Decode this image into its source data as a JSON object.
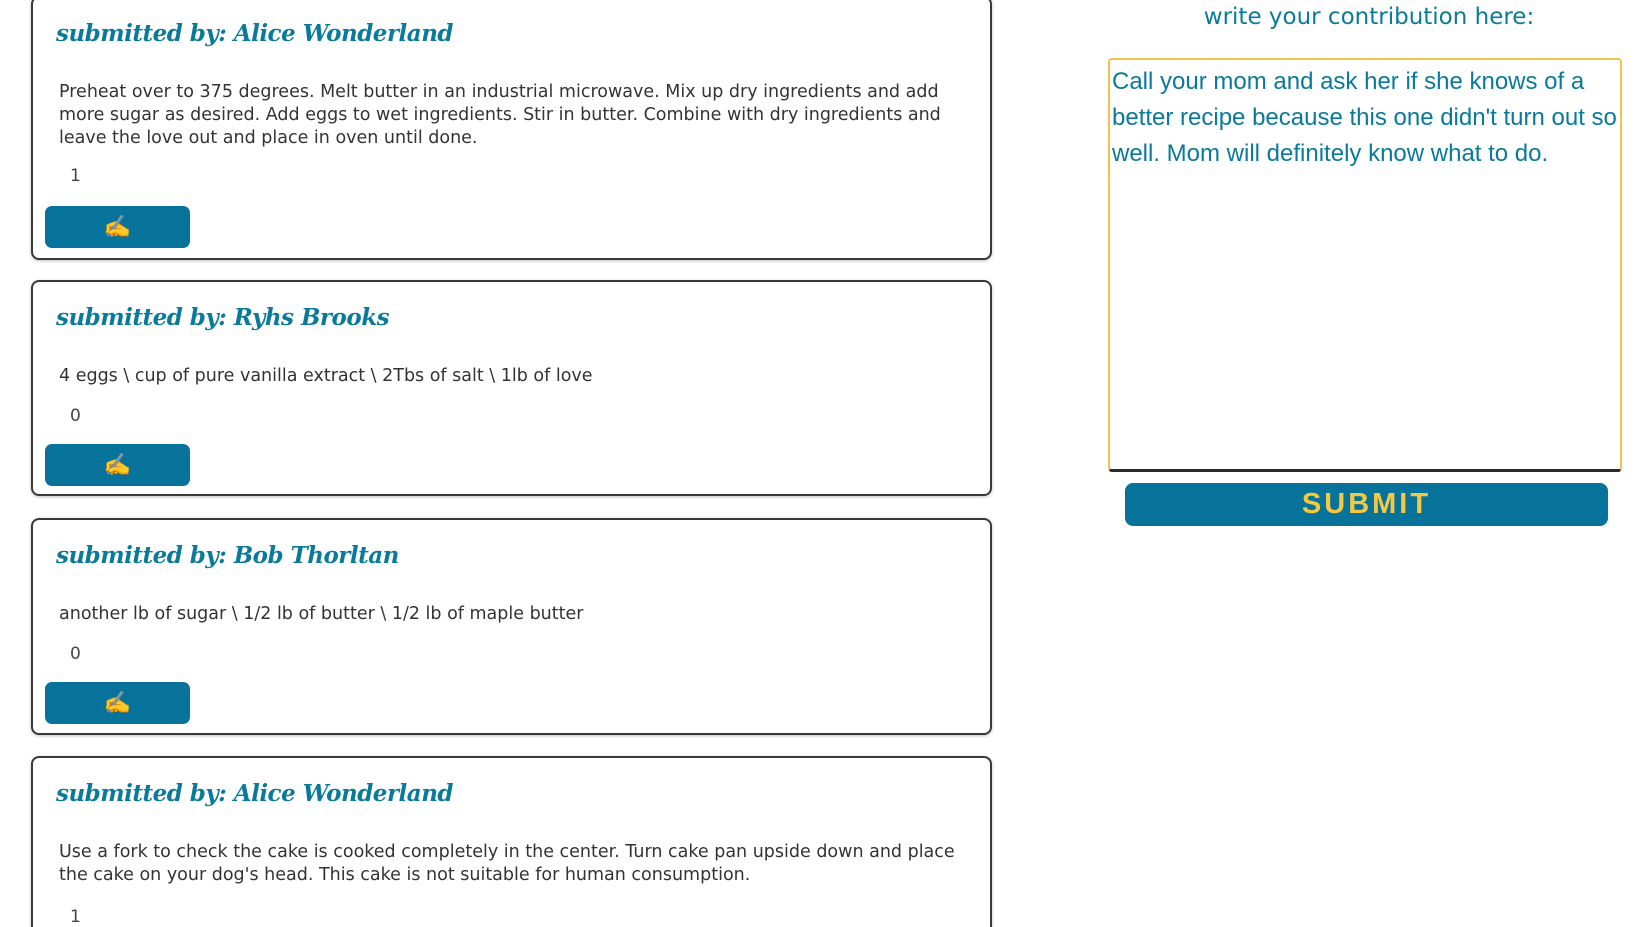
{
  "contributions": [
    {
      "author": "submitted by: Alice Wonderland",
      "text": "Preheat over to 375 degrees. Melt butter in an industrial microwave. Mix up dry ingredients and add more sugar as desired. Add eggs to wet ingredients. Stir in butter. Combine with dry ingredients and leave the love out and place in oven until done.",
      "count": "1",
      "button_icon": "✍️",
      "button_icon_name": "writing-hand-icon"
    },
    {
      "author": "submitted by: Ryhs Brooks",
      "text": "4 eggs \\ cup of pure vanilla extract \\ 2Tbs of salt \\ 1lb of love",
      "count": "0",
      "button_icon": "✍️",
      "button_icon_name": "writing-hand-icon"
    },
    {
      "author": "submitted by: Bob Thorltan",
      "text": "another lb of sugar \\ 1/2 lb of butter \\ 1/2 lb of maple butter",
      "count": "0",
      "button_icon": "✍️",
      "button_icon_name": "writing-hand-icon"
    },
    {
      "author": "submitted by: Alice Wonderland",
      "text": "Use a fork to check the cake is cooked completely in the center. Turn cake pan upside down and place the cake on your dog's head. This cake is not suitable for human consumption.",
      "count": "1"
    }
  ],
  "side": {
    "heading": "write your contribution here:",
    "textarea_value": "Call your mom and ask her if she knows of a better recipe because this one didn't turn out so well. Mom will definitely know what to do. ",
    "submit_label": "SUBMIT"
  },
  "colors": {
    "accent": "#07739a",
    "accent_text": "#f5c842",
    "heading_text": "#0a7a9a",
    "textarea_border": "#f2c14e"
  }
}
